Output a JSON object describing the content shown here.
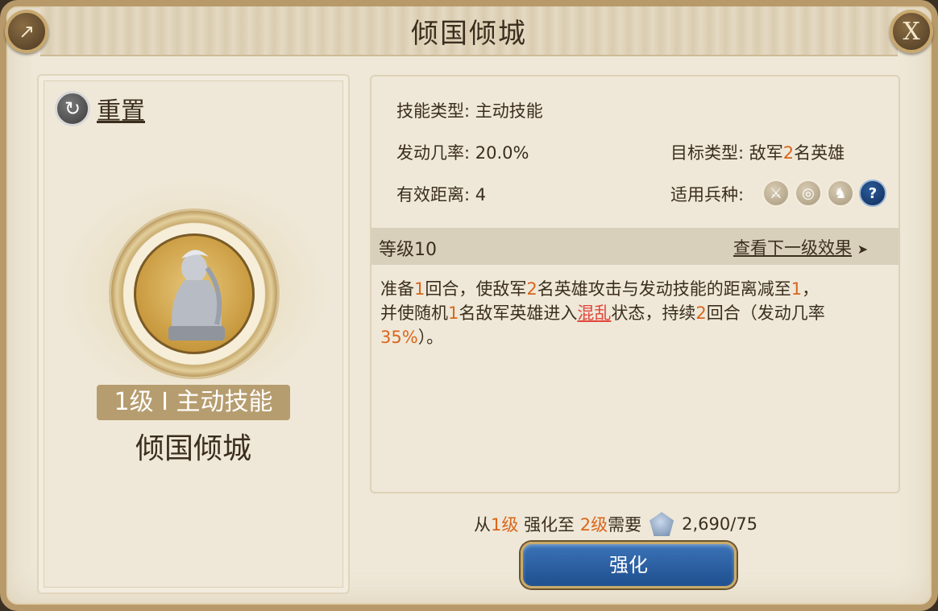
{
  "title": "倾国倾城",
  "reset_label": "重置",
  "skill": {
    "level_badge": "1级 I 主动技能",
    "name": "倾国倾城"
  },
  "info": {
    "skill_type_label": "技能类型:",
    "skill_type_value": "主动技能",
    "trigger_rate_label": "发动几率:",
    "trigger_rate_value": "20.0%",
    "target_type_label": "目标类型:",
    "target_type_value_pre": "敌军",
    "target_type_value_num": "2",
    "target_type_value_post": "名英雄",
    "range_label": "有效距离:",
    "range_value": "4",
    "unit_types_label": "适用兵种:"
  },
  "unit_icons": [
    "sword-icon",
    "target-icon",
    "horse-icon",
    "question-icon"
  ],
  "level": {
    "label": "等级10",
    "next_label": "查看下一级效果",
    "next_arrow": "➤"
  },
  "description": {
    "p1": "准备",
    "n1": "1",
    "p2": "回合，使敌军",
    "n2": "2",
    "p3": "名英雄攻击与发动技能的距离减至",
    "n3": "1",
    "p4": "，",
    "p5": "并使随机",
    "n4": "1",
    "p6": "名敌军英雄进入",
    "link": "混乱",
    "p7": "状态，持续",
    "n5": "2",
    "p8": "回合（发动几率",
    "n6": "35%",
    "p9": "）。"
  },
  "cost": {
    "from_pre": "从",
    "from_level": "1级",
    "mid": "强化至",
    "to_level": "2级",
    "post": "需要",
    "amount": "2,690/75"
  },
  "upgrade_button": "强化",
  "close_glyph": "X",
  "share_glyph": "↗",
  "reset_glyph": "↻",
  "colors": {
    "accent_orange": "#d9661b",
    "link_red": "#e0453b",
    "button_blue": "#1f4f8e"
  }
}
